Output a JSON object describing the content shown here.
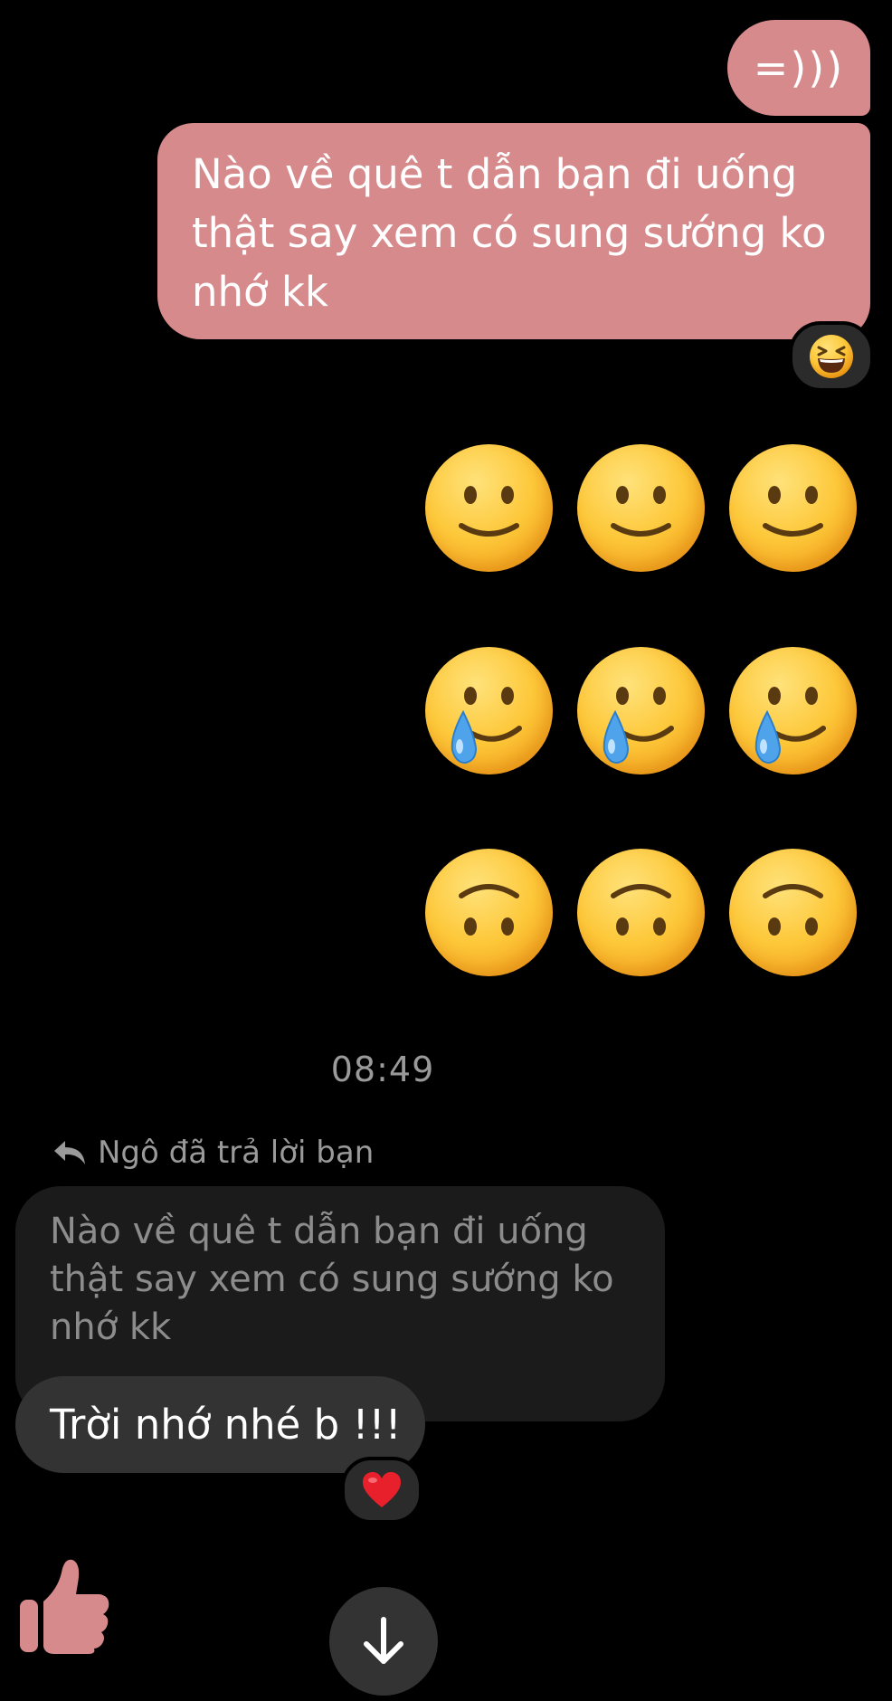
{
  "messages": {
    "outgoing_short": "=)))",
    "outgoing_long_lines": [
      "Nào về quê t dẫn bạn đi uống",
      "thật say xem có sung sướng ko",
      "nhớ kk"
    ],
    "outgoing_long_reaction": "laughing-squint-emoji",
    "emoji_grid": [
      [
        "slightly-smiling-face",
        "slightly-smiling-face",
        "slightly-smiling-face"
      ],
      [
        "smiling-face-with-tear",
        "smiling-face-with-tear",
        "smiling-face-with-tear"
      ],
      [
        "upside-down-face",
        "upside-down-face",
        "upside-down-face"
      ]
    ],
    "timestamp": "08:49",
    "reply_header": "Ngô đã trả lời bạn",
    "quoted_lines": [
      "Nào về quê t dẫn bạn đi uống",
      "thật say xem có sung sướng ko",
      "nhớ kk"
    ],
    "incoming_reply": "Trời nhớ nhé b !!!",
    "incoming_reaction": "red-heart-emoji"
  },
  "controls": {
    "like_icon": "thumbs-up-icon",
    "scroll_icon": "arrow-down-icon"
  },
  "colors": {
    "background": "#000000",
    "outgoing_bubble": "#d68a8b",
    "incoming_bubble": "#333333",
    "quoted_bubble": "#1b1b1b",
    "muted_text": "#9a9a9a"
  }
}
